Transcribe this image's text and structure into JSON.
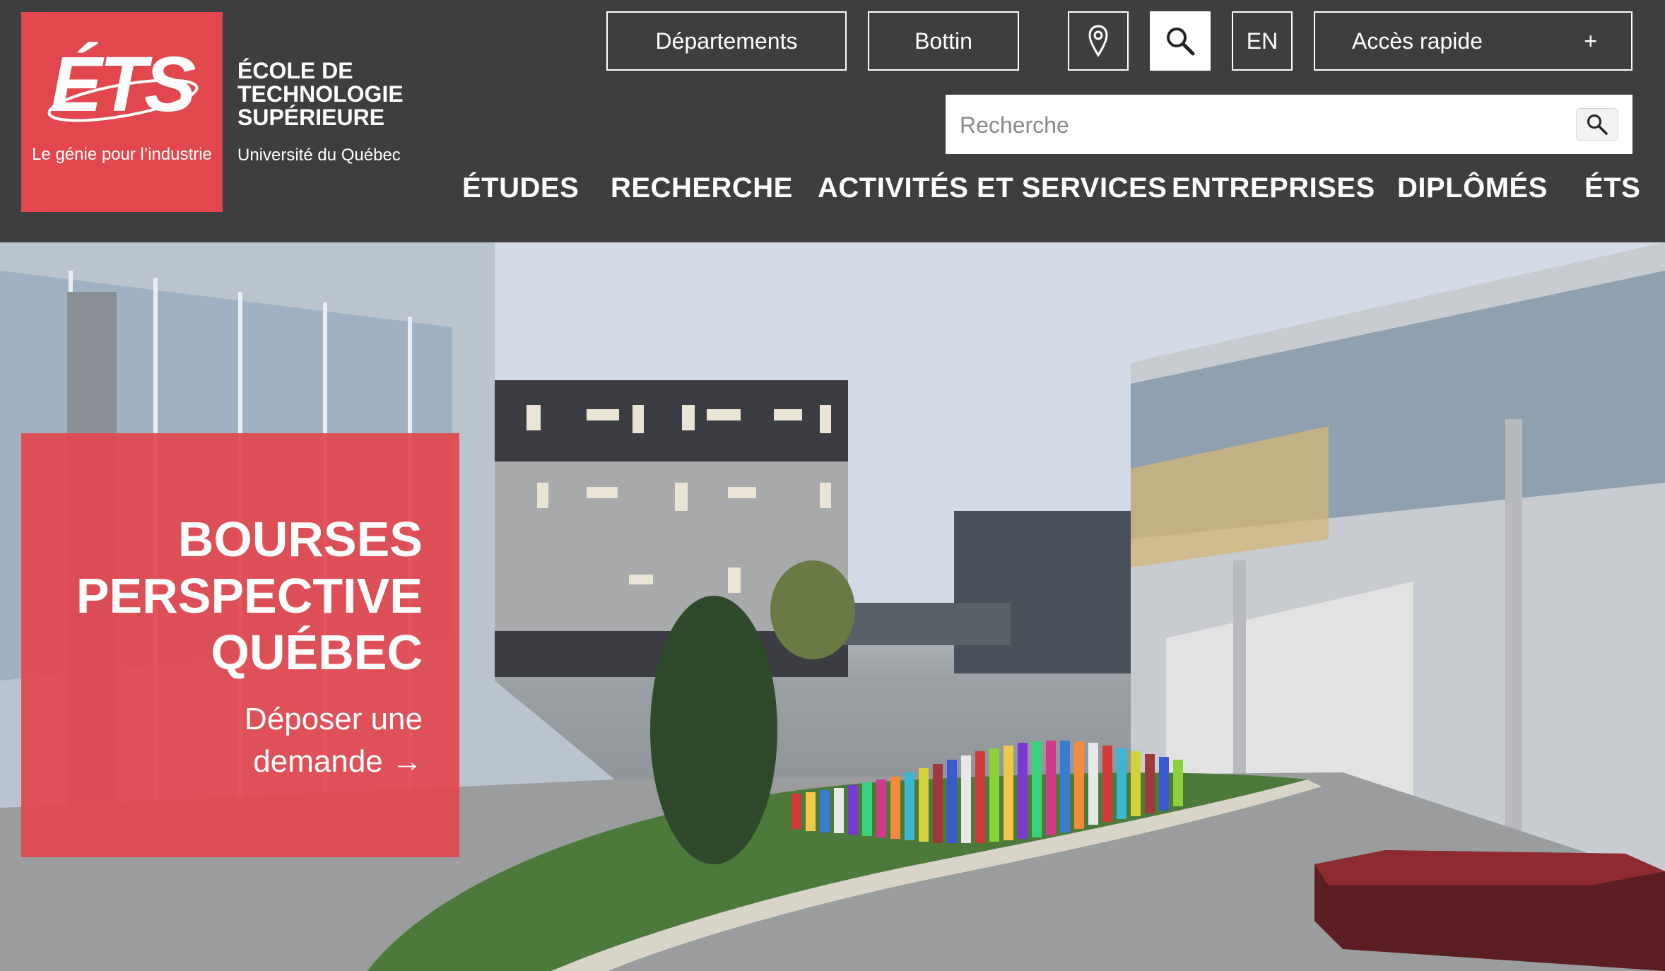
{
  "logo": {
    "mark": "ÉTS",
    "tagline": "Le génie pour l’industrie",
    "school_name": "ÉCOLE DE\nTECHNOLOGIE\nSUPÉRIEURE",
    "university": "Université du Québec"
  },
  "top_buttons": {
    "departments": "Départements",
    "directory": "Bottin",
    "language": "EN",
    "quick_access": "Accès rapide",
    "quick_access_toggle": "+"
  },
  "search": {
    "placeholder": "Recherche"
  },
  "nav": [
    "ÉTUDES",
    "RECHERCHE",
    "ACTIVITÉS ET SERVICES",
    "ENTREPRISES",
    "DIPLÔMÉS",
    "ÉTS"
  ],
  "promo": {
    "title": "BOURSES\nPERSPECTIVE\nQUÉBEC",
    "link": "Déposer une\ndemande →"
  },
  "colors": {
    "header_bg": "#3e3e41",
    "brand_red": "#e2474e",
    "white": "#ffffff"
  },
  "icons": {
    "location": "map-pin-icon",
    "search_toggle": "search-icon",
    "search_submit": "search-icon"
  }
}
